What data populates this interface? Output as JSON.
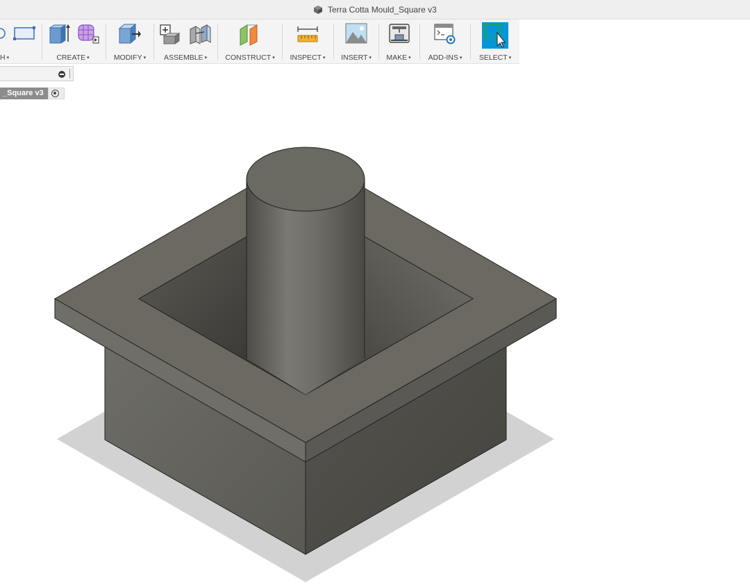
{
  "window": {
    "title": "Terra Cotta Mould_Square v3",
    "icon": "box-icon"
  },
  "toolbar": {
    "groups": [
      {
        "id": "sketch",
        "label": "H",
        "icons": [
          "circle-icon",
          "rectangle-icon"
        ]
      },
      {
        "id": "create",
        "label": "CREATE",
        "icons": [
          "extrude-icon",
          "form-icon"
        ]
      },
      {
        "id": "modify",
        "label": "MODIFY",
        "icons": [
          "press-pull-icon"
        ]
      },
      {
        "id": "assemble",
        "label": "ASSEMBLE",
        "icons": [
          "new-component-icon",
          "joint-icon"
        ]
      },
      {
        "id": "construct",
        "label": "CONSTRUCT",
        "icons": [
          "offset-plane-icon"
        ]
      },
      {
        "id": "inspect",
        "label": "INSPECT",
        "icons": [
          "measure-icon"
        ]
      },
      {
        "id": "insert",
        "label": "INSERT",
        "icons": [
          "insert-image-icon"
        ]
      },
      {
        "id": "make",
        "label": "MAKE",
        "icons": [
          "3d-print-icon"
        ]
      },
      {
        "id": "addins",
        "label": "ADD-INS",
        "icons": [
          "scripts-addins-icon"
        ]
      },
      {
        "id": "select",
        "label": "SELECT",
        "icons": [
          "select-icon"
        ],
        "active": true
      }
    ],
    "caret": "▾"
  },
  "browser": {
    "collapse_icon": "minus-circle-icon"
  },
  "document_tab": {
    "label": "_Square v3",
    "icon": "radio-target-icon"
  },
  "model": {
    "name": "Terra Cotta Mould_Square",
    "shape": "square mould with central cylinder"
  },
  "colors": {
    "select_active": "#0696d7",
    "model_face": "#6b6a62",
    "shadow": "#d2d2d2"
  }
}
